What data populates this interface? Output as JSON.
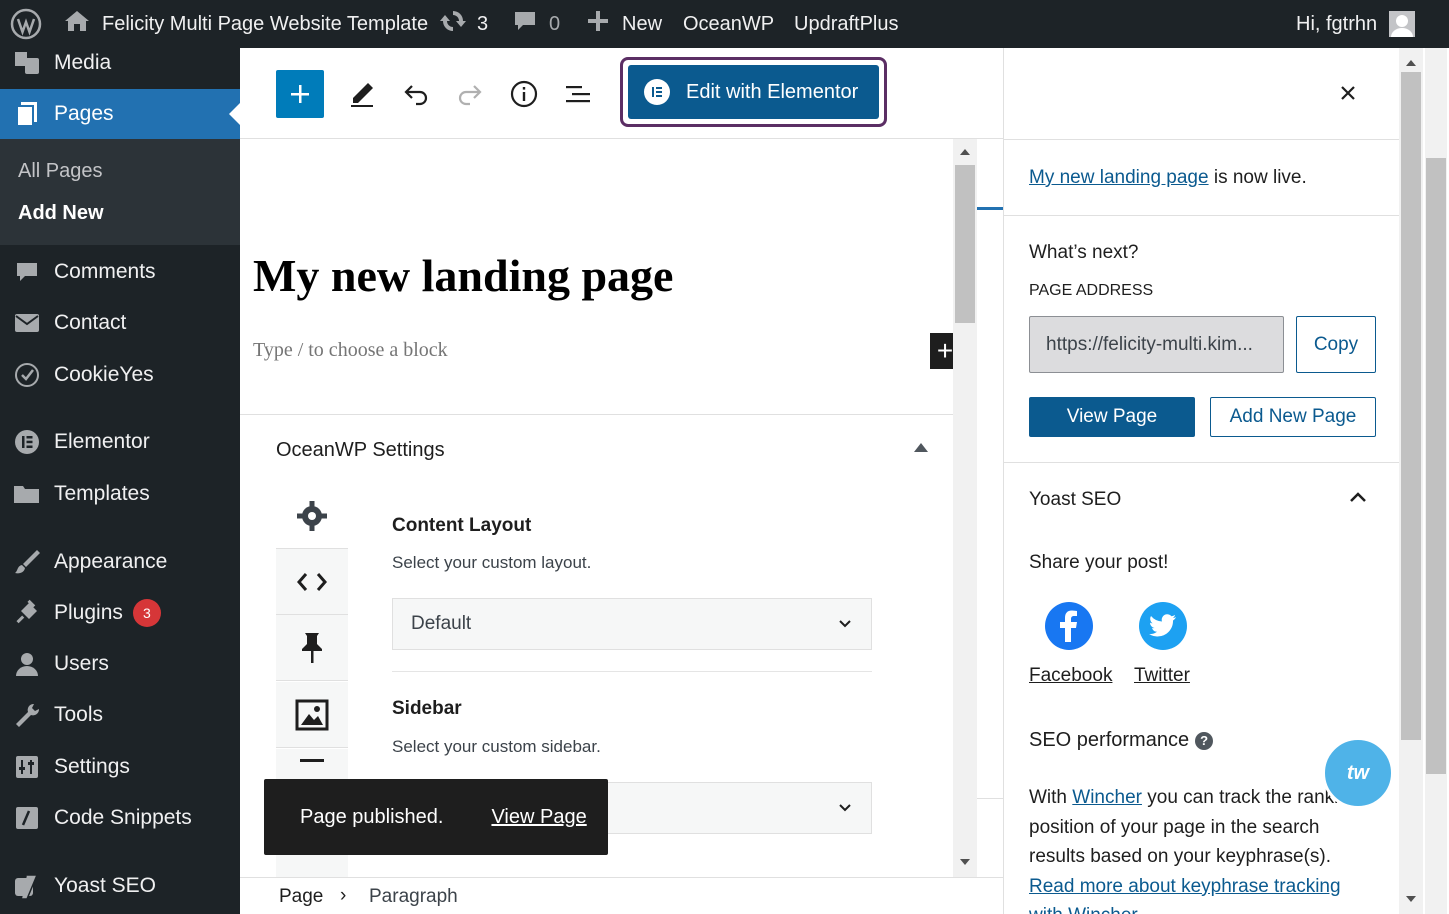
{
  "admin_bar": {
    "site_name": "Felicity Multi Page Website Template",
    "updates_count": "3",
    "comments_count": "0",
    "new_label": "New",
    "oceanwp_label": "OceanWP",
    "updraft_label": "UpdraftPlus",
    "greeting": "Hi, fgtrhn"
  },
  "sidebar": {
    "media": "Media",
    "pages": "Pages",
    "submenu": {
      "all_pages": "All Pages",
      "add_new": "Add New"
    },
    "comments": "Comments",
    "contact": "Contact",
    "cookieyes": "CookieYes",
    "elementor": "Elementor",
    "templates": "Templates",
    "appearance": "Appearance",
    "plugins": "Plugins",
    "plugins_badge": "3",
    "users": "Users",
    "tools": "Tools",
    "settings": "Settings",
    "code_snippets": "Code Snippets",
    "yoast": "Yoast SEO"
  },
  "toolbar": {
    "edit_elementor": "Edit with Elementor"
  },
  "editor": {
    "title": "My new landing page",
    "placeholder": "Type / to choose a block",
    "inserter": "+"
  },
  "oceanwp": {
    "title": "OceanWP Settings",
    "content_layout_label": "Content Layout",
    "content_layout_desc": "Select your custom layout.",
    "content_layout_value": "Default",
    "sidebar_label": "Sidebar",
    "sidebar_desc": "Select your custom sidebar."
  },
  "snackbar": {
    "message": "Page published.",
    "action": "View Page"
  },
  "breadcrumb": {
    "page": "Page",
    "separator": "›",
    "block": "Paragraph"
  },
  "panel": {
    "live_link": "My new landing page",
    "live_suffix": "is now live.",
    "whats_next": "What’s next?",
    "address_label": "PAGE ADDRESS",
    "address_value": "https://felicity-multi.kim...",
    "copy": "Copy",
    "view_page": "View Page",
    "add_new_page": "Add New Page",
    "yoast_title": "Yoast SEO",
    "share": "Share your post!",
    "facebook": "Facebook",
    "twitter": "Twitter",
    "seo_performance": "SEO performance",
    "help_icon": "?",
    "wincher_pre": "With",
    "wincher_link": "Wincher",
    "wincher_line1_rest": "you can track the ranking",
    "wincher_line2": "position of your page in the search",
    "wincher_line3": "results based on your keyphrase(s).",
    "read_more_1": "Read more about keyphrase tracking",
    "read_more_2": "with Wincher",
    "wincher_bubble": "tw"
  },
  "colors": {
    "admin_dark": "#1d2327",
    "wp_blue": "#2271b1",
    "button_blue": "#0b5a8f",
    "badge_red": "#d63638"
  }
}
